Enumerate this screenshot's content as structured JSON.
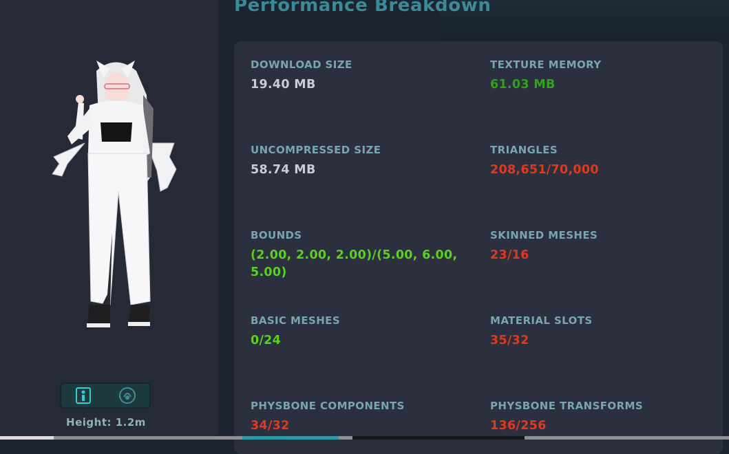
{
  "header": {
    "title": "Performance Breakdown"
  },
  "avatar_panel": {
    "height_label": "Height: 1.2m",
    "toggle": [
      {
        "icon": "avatar-info-icon"
      },
      {
        "icon": "avatar-stats-icon"
      }
    ]
  },
  "stats": [
    {
      "label": "DOWNLOAD SIZE",
      "value": "19.40 MB",
      "status_color": "#c9ccd3"
    },
    {
      "label": "TEXTURE MEMORY",
      "value": "61.03 MB",
      "status_color": "#2ea41a"
    },
    {
      "label": "UNCOMPRESSED SIZE",
      "value": "58.74 MB",
      "status_color": "#c9ccd3"
    },
    {
      "label": "TRIANGLES",
      "value": "208,651/70,000",
      "status_color": "#e03a1d"
    },
    {
      "label": "BOUNDS",
      "value": "(2.00, 2.00, 2.00)/(5.00, 6.00, 5.00)",
      "status_color": "#58d21e"
    },
    {
      "label": "SKINNED MESHES",
      "value": "23/16",
      "status_color": "#e03a1d"
    },
    {
      "label": "BASIC MESHES",
      "value": "0/24",
      "status_color": "#58d21e"
    },
    {
      "label": "MATERIAL SLOTS",
      "value": "35/32",
      "status_color": "#e03a1d"
    },
    {
      "label": "PHYSBONE COMPONENTS",
      "value": "34/32",
      "status_color": "#e03a1d"
    },
    {
      "label": "PHYSBONE TRANSFORMS",
      "value": "136/256",
      "status_color": "#e03a1d"
    }
  ]
}
